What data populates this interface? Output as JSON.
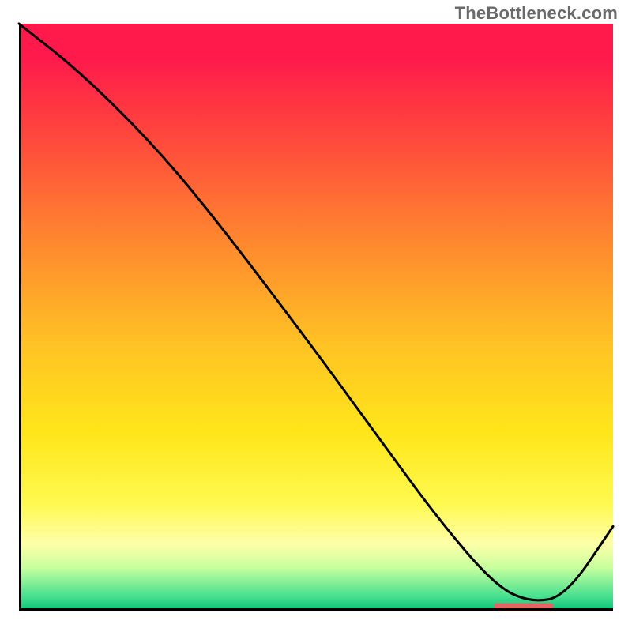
{
  "watermark": "TheBottleneck.com",
  "chart_data": {
    "type": "line",
    "title": "",
    "xlabel": "",
    "ylabel": "",
    "xlim": [
      0,
      100
    ],
    "ylim": [
      0,
      100
    ],
    "grid": false,
    "legend": false,
    "series": [
      {
        "name": "bottleneck-curve",
        "color": "#000000",
        "x": [
          0,
          10,
          22,
          32,
          47,
          60,
          70,
          80,
          86,
          92,
          100
        ],
        "values": [
          100,
          92,
          80,
          68,
          48,
          30,
          16,
          4,
          1,
          2,
          14
        ]
      }
    ],
    "marker": {
      "name": "optimal-range-marker",
      "x_range": [
        80,
        90
      ],
      "y": 0.2,
      "color": "#e06666"
    },
    "background_gradient": {
      "orientation": "vertical",
      "stops": [
        {
          "pos": 0.0,
          "color": "#ff1a4b"
        },
        {
          "pos": 0.55,
          "color": "#ffe61a"
        },
        {
          "pos": 0.93,
          "color": "#c8ff9e"
        },
        {
          "pos": 1.0,
          "color": "#12c77a"
        }
      ]
    }
  }
}
